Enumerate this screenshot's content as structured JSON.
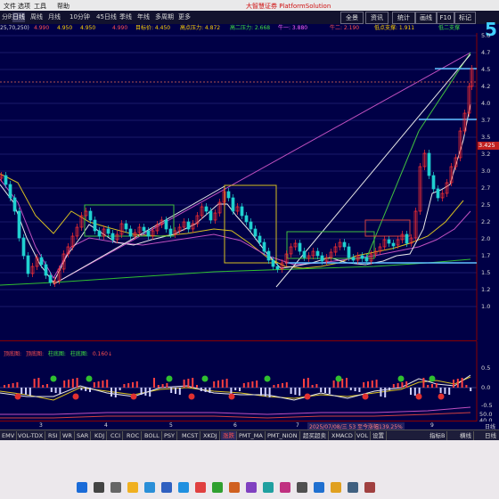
{
  "menubar": {
    "items": [
      "文件",
      "选项",
      "工具",
      "帮助"
    ],
    "title": "大智慧证券 PlatformSolution"
  },
  "periods": [
    "分时",
    "日线",
    "周线",
    "月线",
    "10分钟",
    "45日线",
    "季线",
    "年线",
    "多周期",
    "更多"
  ],
  "active_period": "日线",
  "right_buttons": [
    "全景",
    "资讯",
    "统计",
    "画线",
    "F10",
    "标记"
  ],
  "info_row": [
    {
      "text": "25,70,250)",
      "color": "#d8d8d8"
    },
    {
      "text": "4.990",
      "color": "#ff5050"
    },
    {
      "text": "4.950",
      "color": "#ffd400"
    },
    {
      "text": "4.950",
      "color": "#ffd400"
    },
    {
      "text": "4.990",
      "color": "#ff5050"
    },
    {
      "text": "目标价: 4.450",
      "color": "#ffd400"
    },
    {
      "text": "高点压力: 4.872",
      "color": "#ffd400"
    },
    {
      "text": "高二压力: 2.668",
      "color": "#40e040"
    },
    {
      "text": "牛一: 3.880",
      "color": "#ff60ff"
    },
    {
      "text": "牛二: 2.190",
      "color": "#ff5050"
    },
    {
      "text": "低点支撑: 1.911",
      "color": "#ffd400"
    },
    {
      "text": "低二支撑",
      "color": "#40e040"
    }
  ],
  "price_axis": [
    "5.0",
    "4.7",
    "4.5",
    "4.2",
    "4.0",
    "3.7",
    "3.5",
    "3.2",
    "3.0",
    "2.7",
    "2.5",
    "2.2",
    "2.0",
    "1.7",
    "1.5",
    "1.2",
    "1.0"
  ],
  "price_tag": "3.425",
  "big_number": "5",
  "indicator": {
    "labels": [
      {
        "text": "顶底图:",
        "color": "#ff5050"
      },
      {
        "text": "顶底图:",
        "color": "#ff5050"
      },
      {
        "text": "柱底图:",
        "color": "#40e040"
      },
      {
        "text": "柱底图:",
        "color": "#40e040"
      },
      {
        "text": "0.160↓",
        "color": "#ff5050"
      }
    ],
    "axis": [
      "0.5",
      "0.0",
      "-0.5"
    ],
    "axis2": [
      "50.0",
      "40.0"
    ]
  },
  "date_axis": [
    "3",
    "4",
    "5",
    "6",
    "7",
    "9"
  ],
  "status_text": "2025/07/08/三 53 至今涨幅139.25%",
  "tabs": [
    "EMV",
    "VOL-TDX",
    "RSI",
    "WR",
    "SAR",
    "KDJ",
    "CCI",
    "ROC",
    "BOLL",
    "PSY",
    "MCST",
    "XKDJ",
    "涨跌",
    "PMT_MA",
    "PMT_NION",
    "超买超卖",
    "XMACD",
    "VOL",
    "设置"
  ],
  "active_tab": "涨跌",
  "tab_right": [
    "指标B",
    "横线"
  ],
  "right_side": {
    "top": "日线",
    "bottom": "日线"
  },
  "taskbar_icons": [
    "windows",
    "search",
    "taskview",
    "explorer",
    "edge",
    "store",
    "mail",
    "app1",
    "app2",
    "app3",
    "app4",
    "app5",
    "app6",
    "app7",
    "app8",
    "app9",
    "app10",
    "app11"
  ]
}
